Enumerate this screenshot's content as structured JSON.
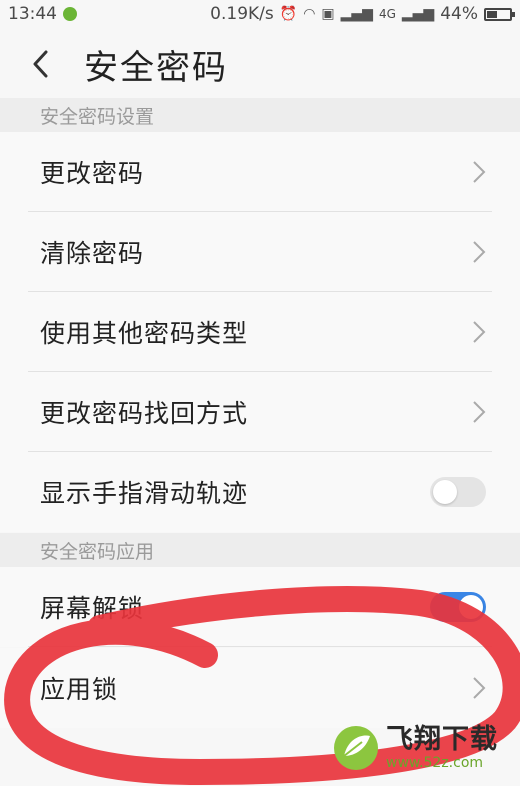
{
  "status_bar": {
    "time": "13:44",
    "network_speed": "0.19K/s",
    "signal_label": "4G",
    "battery": "44%",
    "battery_level": 0.44
  },
  "header": {
    "title": "安全密码"
  },
  "sections": [
    {
      "label": "安全密码设置",
      "items": [
        {
          "label": "更改密码",
          "control": "chevron"
        },
        {
          "label": "清除密码",
          "control": "chevron"
        },
        {
          "label": "使用其他密码类型",
          "control": "chevron"
        },
        {
          "label": "更改密码找回方式",
          "control": "chevron"
        },
        {
          "label": "显示手指滑动轨迹",
          "control": "toggle",
          "state": "off"
        }
      ]
    },
    {
      "label": "安全密码应用",
      "items": [
        {
          "label": "屏幕解锁",
          "control": "toggle",
          "state": "on"
        },
        {
          "label": "应用锁",
          "control": "chevron"
        }
      ]
    }
  ],
  "watermark": {
    "name": "飞翔下载",
    "url": "www.52z.com"
  },
  "colors": {
    "toggle_on": "#3a86e6",
    "annotation_red": "#e8343c"
  }
}
